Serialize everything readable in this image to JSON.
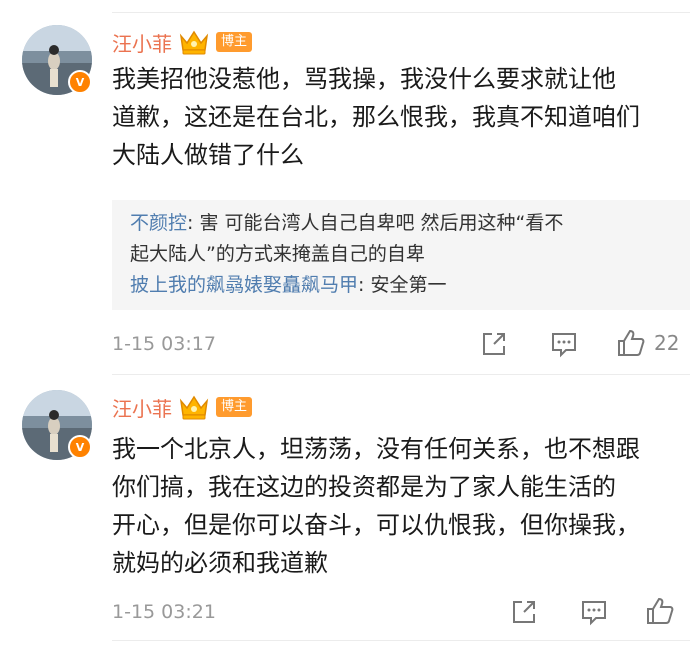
{
  "comments": [
    {
      "username": "汪小菲",
      "role_badge": "博主",
      "text": "我美招他没惹他，骂我操，我没什么要求就让他\n道歉，这还是在台北，那么恨我，我真不知道咱们\n大陆人做错了什么",
      "replies": [
        {
          "author": "不颜控",
          "sep": ": ",
          "text": "害 可能台湾人自己自卑吧 然后用这种“看不\n起大陆人”的方式来掩盖自己的自卑"
        },
        {
          "author": "披上我的飙骉婊娶矗飙马甲",
          "sep": ": ",
          "text": "安全第一"
        }
      ],
      "timestamp": "1-15 03:17",
      "like_count": "22"
    },
    {
      "username": "汪小菲",
      "role_badge": "博主",
      "text": "我一个北京人，坦荡荡，没有任何关系，也不想跟\n你们搞，我在这边的投资都是为了家人能生活的\n开心，但是你可以奋斗，可以仇恨我，但你操我，\n就妈的必须和我道歉",
      "timestamp": "1-15 03:21"
    }
  ],
  "colors": {
    "username": "#eb7350",
    "reply_author": "#507daf",
    "badge": "#ff9b2e",
    "verified": "#ff8200"
  },
  "icons": [
    "crown-icon",
    "verified-icon",
    "share-icon",
    "comment-icon",
    "like-icon"
  ]
}
